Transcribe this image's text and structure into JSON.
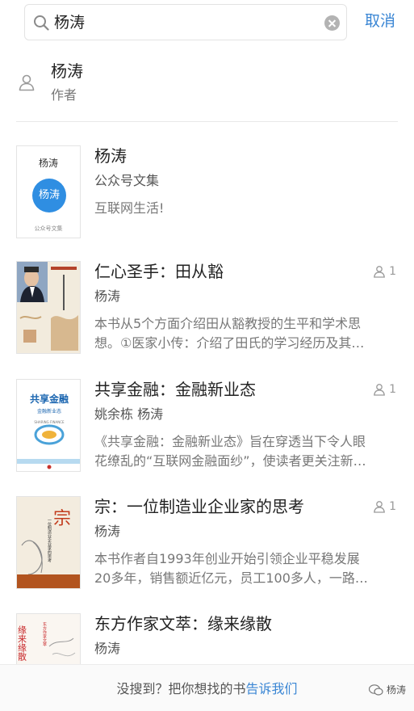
{
  "search": {
    "query": "杨涛",
    "cancel_label": "取消"
  },
  "author": {
    "name": "杨涛",
    "role": "作者"
  },
  "results": [
    {
      "title": "杨涛",
      "subtitle": "公众号文集",
      "desc": [
        "互联网生活!"
      ],
      "cover": {
        "name": "杨涛",
        "circle": "杨涛",
        "foot": "公众号文集"
      }
    },
    {
      "title": "仁心圣手：田从豁",
      "subtitle": "杨涛",
      "count": "1",
      "desc": [
        "本书从5个方面介绍田从豁教授的生平和学术思",
        "想。①医家小传：介绍了田氏的学习经历及其…"
      ]
    },
    {
      "title": "共享金融：金融新业态",
      "subtitle": "姚余栋 杨涛",
      "count": "1",
      "desc": [
        "《共享金融：金融新业态》旨在穿透当下令人眼",
        "花缭乱的“互联网金融面纱”，使读者更关注新…"
      ],
      "cover": {
        "title": "共享金融",
        "subtitle": "金融新业态",
        "tag": "SHARING FINANCE"
      }
    },
    {
      "title": "宗：一位制造业企业家的思考",
      "subtitle": "杨涛",
      "count": "1",
      "desc": [
        "本书作者自1993年创业开始引领企业平稳发展",
        "20多年，销售额近亿元，员工100多人，一路…"
      ],
      "cover": {
        "big": "宗",
        "side": "一位制造业企业家的思考"
      }
    },
    {
      "title": "东方作家文萃：缘来缘散",
      "subtitle": "杨涛",
      "cover": {
        "big": "缘来缘散",
        "side": "东方作家文萃"
      }
    }
  ],
  "bottom": {
    "prefix": "没搜到？把你想找的书",
    "link": "告诉我们",
    "watermark": "杨涛"
  },
  "colors": {
    "accent": "#3a86d4",
    "circle": "#2f8ee2"
  }
}
